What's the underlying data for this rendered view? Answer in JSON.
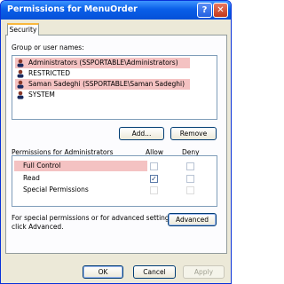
{
  "window": {
    "title": "Permissions for MenuOrder",
    "help_glyph": "?",
    "close_glyph": "✕"
  },
  "tabs": [
    {
      "label": "Security"
    }
  ],
  "group_section": {
    "label": "Group or user names:",
    "items": [
      {
        "label": "Administrators (SSPORTABLE\\Administrators)",
        "highlighted": true
      },
      {
        "label": "RESTRICTED",
        "highlighted": false
      },
      {
        "label": "Saman Sadeghi (SSPORTABLE\\Saman Sadeghi)",
        "highlighted": true
      },
      {
        "label": "SYSTEM",
        "highlighted": false
      }
    ]
  },
  "buttons": {
    "add": "Add...",
    "remove": "Remove",
    "advanced": "Advanced",
    "ok": "OK",
    "cancel": "Cancel",
    "apply": "Apply"
  },
  "permissions": {
    "label": "Permissions for Administrators",
    "allow_header": "Allow",
    "deny_header": "Deny",
    "rows": [
      {
        "name": "Full Control",
        "allow": false,
        "deny": false,
        "highlighted": true
      },
      {
        "name": "Read",
        "allow": true,
        "deny": false,
        "highlighted": false
      },
      {
        "name": "Special Permissions",
        "allow": false,
        "deny": false,
        "highlighted": false
      }
    ]
  },
  "advanced_note": {
    "line1": "For special permissions or for advanced settings,",
    "line2": "click Advanced."
  },
  "colors": {
    "highlight": "#f4c2c2",
    "titlebar": "#0a5fe8",
    "dialog_bg": "#ece9d8"
  },
  "icons": {
    "user": "user-icon",
    "check": "✓"
  }
}
